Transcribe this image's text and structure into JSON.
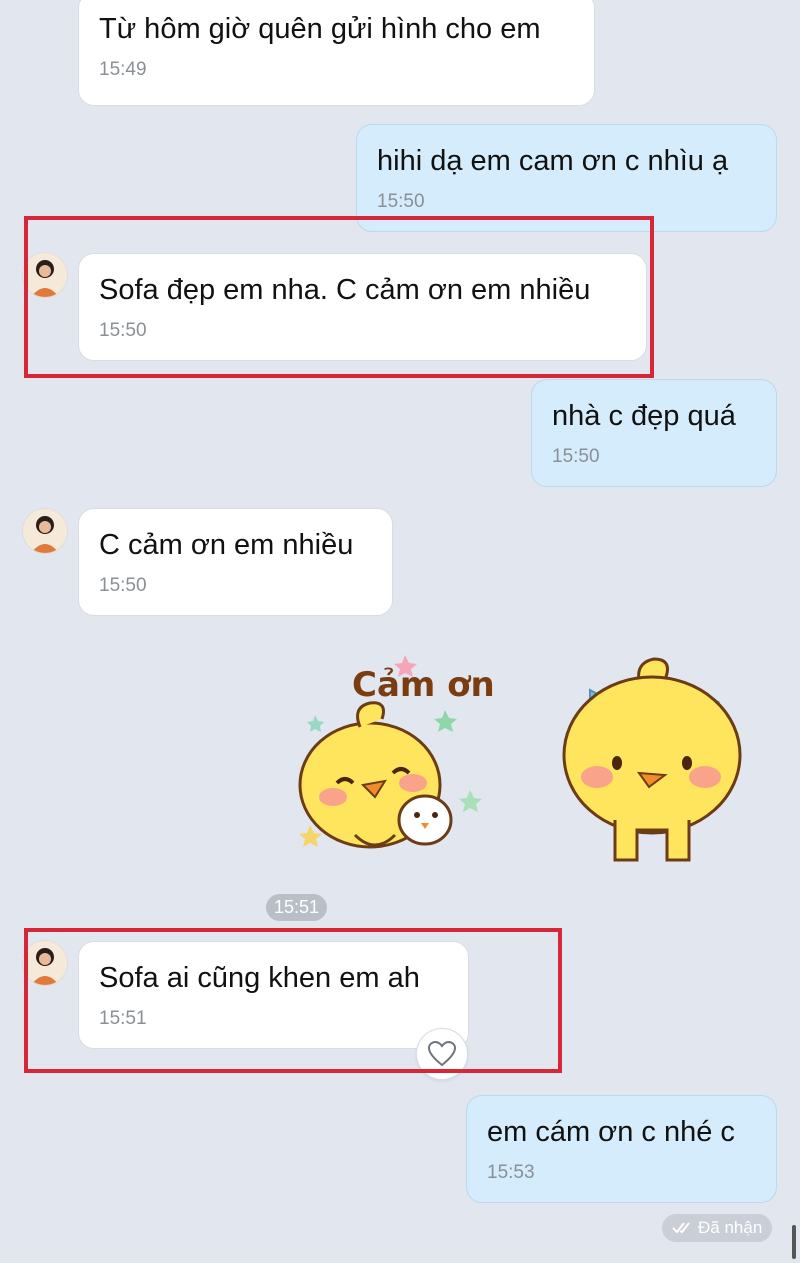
{
  "messages": [
    {
      "text": "Từ hôm giờ quên gửi hình cho em",
      "time": "15:49",
      "side": "in"
    },
    {
      "text": "hihi dạ em cam ơn c nhìu ạ",
      "time": "15:50",
      "side": "out"
    },
    {
      "text": "Sofa đẹp em nha. C cảm ơn em nhiều",
      "time": "15:50",
      "side": "in"
    },
    {
      "text": "nhà c đẹp quá",
      "time": "15:50",
      "side": "out"
    },
    {
      "text": "C cảm ơn em nhiều",
      "time": "15:50",
      "side": "in"
    },
    {
      "text": "Sofa ai cũng khen em ah",
      "time": "15:51",
      "side": "in"
    },
    {
      "text": "em cám ơn c nhé c",
      "time": "15:53",
      "side": "out"
    }
  ],
  "sticker": {
    "caption": "Cảm ơn",
    "time": "15:51"
  },
  "status": {
    "label": "Đã nhận",
    "icon": "double-check-icon"
  },
  "icons": {
    "reaction": "heart-icon"
  },
  "colors": {
    "highlight": "#d72638",
    "incoming": "#ffffff",
    "outgoing": "#d4ecfb",
    "background": "#e2e6ee"
  }
}
